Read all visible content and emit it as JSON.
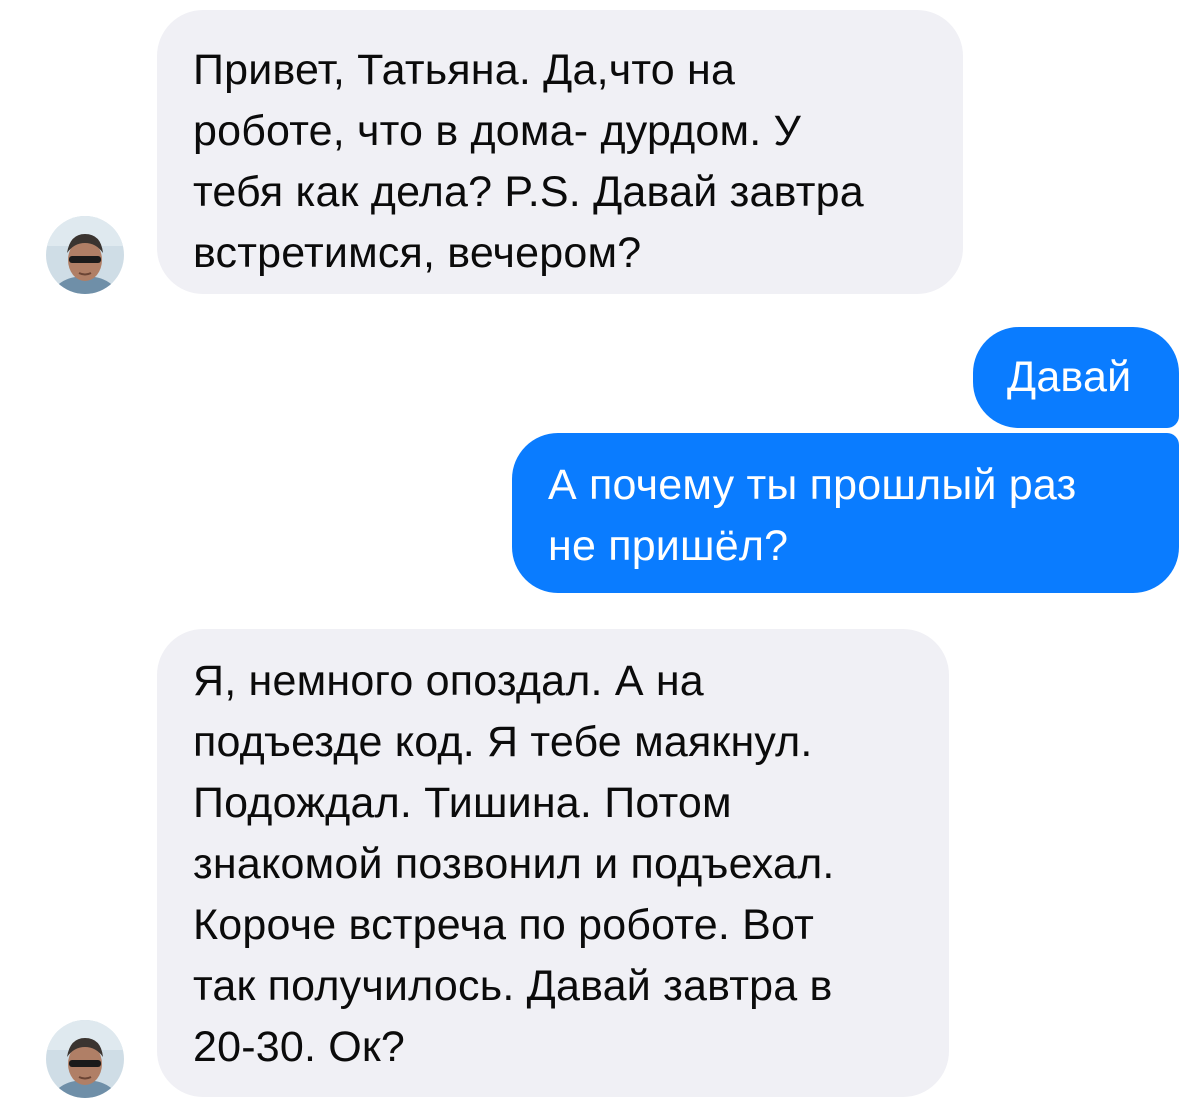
{
  "chat": {
    "messages": [
      {
        "direction": "incoming",
        "text": "Привет, Татьяна. Да,что на\nроботе, что в дома- дурдом. У\nтебя как дела? P.S. Давай завтра\nвстретимся, вечером?",
        "has_avatar": true
      },
      {
        "direction": "outgoing",
        "text": "Давай",
        "has_avatar": false
      },
      {
        "direction": "outgoing",
        "text": "А почему ты прошлый раз\nне пришёл?",
        "has_avatar": false
      },
      {
        "direction": "incoming",
        "text": "Я, немного опоздал. А на\nподъезде код. Я тебе маякнул.\nПодождал. Тишина. Потом\nзнакомой позвонил и подъехал.\nКороче встреча по роботе. Вот\nтак получилось. Давай завтра в\n20-30. Ок?",
        "has_avatar": true
      }
    ]
  },
  "colors": {
    "incoming_bubble": "#f0f0f5",
    "incoming_text": "#0b0b0b",
    "outgoing_bubble": "#0a7cff",
    "outgoing_text": "#ffffff",
    "background": "#ffffff"
  },
  "icons": {
    "avatar": "contact-avatar-photo"
  }
}
